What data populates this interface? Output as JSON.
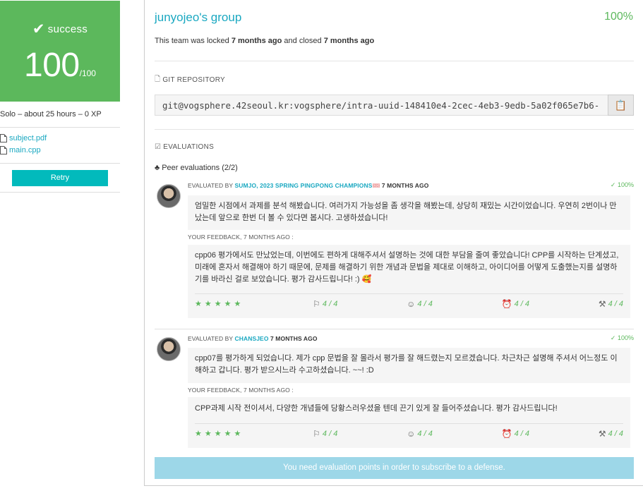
{
  "sidebar": {
    "status_label": "success",
    "score_value": "100",
    "score_max": "/100",
    "solo_info": "Solo – about 25 hours – 0 XP",
    "files": [
      {
        "name": "subject.pdf"
      },
      {
        "name": "main.cpp"
      }
    ],
    "retry_label": "Retry"
  },
  "team": {
    "title": "junyojeo's group",
    "percent": "100%",
    "lock_prefix": "This team was locked",
    "locked_when": "7 months ago",
    "lock_middle": "and closed",
    "closed_when": "7 months ago"
  },
  "git": {
    "section_label": "GIT REPOSITORY",
    "url": "git@vogsphere.42seoul.kr:vogsphere/intra-uuid-148410e4-2cec-4eb3-9edb-5a02f065e7b6-"
  },
  "evaluations": {
    "section_label": "EVALUATIONS",
    "peer_label": "Peer evaluations (2/2)",
    "items": [
      {
        "evaluated_by": "EVALUATED BY",
        "login": "SUMJO, 2023 SPRING PINGPONG CHAMPIONS",
        "title_icon": "🎟",
        "when": "7 MONTHS AGO",
        "percent": "100%",
        "comment": "엄밀한 시점에서 과제를 분석 해봤습니다. 여러가지 가능성을 좀 생각을 해봤는데, 상당히 재밌는 시간이었습니다. 우연히 2번이나 만났는데 앞으로 한번 더 볼 수 있다면 봅시다. 고생하셨습니다!",
        "feedback_label": "YOUR FEEDBACK, 7 MONTHS AGO :",
        "feedback": "cpp06 평가에서도 만났었는데, 이번에도 편하게 대해주셔서 설명하는 것에 대한 부담을 줄여 좋았습니다! CPP를 시작하는 단계셨고, 미래에 혼자서 해결해야 하기 때문에, 문제를 해결하기 위한 개념과 문법을 제대로 이해하고, 아이디어를 어떻게 도출했는지를 설명하기를 바라신 걸로 보았습니다. 평가 감사드립니다! :) 🥰",
        "stars": "★★★★★",
        "metrics": [
          "4 / 4",
          "4 / 4",
          "4 / 4",
          "4 / 4"
        ]
      },
      {
        "evaluated_by": "EVALUATED BY",
        "login": "CHANSJEO",
        "title_icon": "",
        "when": "7 MONTHS AGO",
        "percent": "100%",
        "comment": "cpp07를 평가하게 되었습니다. 제가 cpp 문법을 잘 몰라서 평가를 잘 해드렸는지 모르겠습니다. 차근차근 설명해 주셔서 어느정도 이해하고 갑니다. 평가 받으시느라 수고하셨습니다. ~~! :D",
        "feedback_label": "YOUR FEEDBACK, 7 MONTHS AGO :",
        "feedback": "CPP과제 시작 전이셔서, 다양한 개념들에 당황스러우셨을 텐데 끈기 있게 잘 들어주셨습니다. 평가 감사드립니다!",
        "stars": "★★★★★",
        "metrics": [
          "4 / 4",
          "4 / 4",
          "4 / 4",
          "4 / 4"
        ]
      }
    ]
  },
  "defense_notice": "You need evaluation points in order to subscribe to a defense.",
  "colors": {
    "success": "#5cb85c",
    "accent": "#1aa8c1",
    "retry": "#02babc",
    "defense": "#9dd7e8"
  }
}
